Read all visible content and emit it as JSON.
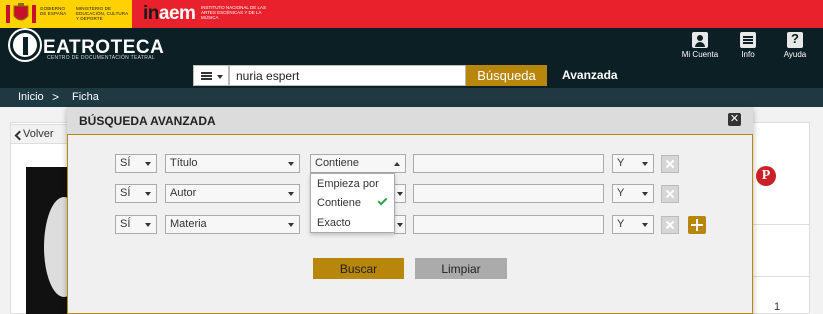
{
  "gov": {
    "text1": "GOBIERNO DE ESPAÑA",
    "text2": "MINISTERIO DE EDUCACIÓN, CULTURA Y DEPORTE",
    "inaem_logo_a": "in",
    "inaem_logo_b": "aem",
    "inaem_sub": "INSTITUTO NACIONAL DE LAS ARTES ESCÉNICAS Y DE LA MÚSICA"
  },
  "header": {
    "logo_text": "EATROTECA",
    "logo_sub": "CENTRO DE DOCUMENTACIÓN TEATRAL",
    "tools": {
      "account": "Mi Cuenta",
      "info": "Info",
      "help": "Ayuda"
    }
  },
  "search": {
    "value": "nuria espert",
    "button": "Búsqueda",
    "advanced": "Avanzada"
  },
  "breadcrumb": {
    "home": "Inicio",
    "separator": ">",
    "current": "Ficha"
  },
  "page": {
    "back": "Volver",
    "pinterest": "P",
    "page_number": "1"
  },
  "modal": {
    "title": "BÚSQUEDA AVANZADA",
    "close": "✕",
    "rows": [
      {
        "negation": "SÍ",
        "field": "Título",
        "operator": "Contiene",
        "connector": "Y"
      },
      {
        "negation": "SÍ",
        "field": "Autor",
        "operator": "",
        "connector": "Y"
      },
      {
        "negation": "SÍ",
        "field": "Materia",
        "operator": "",
        "connector": "Y"
      }
    ],
    "operator_options": [
      "Empieza por",
      "Contiene",
      "Exacto"
    ],
    "search_button": "Buscar",
    "clear_button": "Limpiar"
  },
  "colors": {
    "gold": "#b8860b",
    "dark": "#0c1f25",
    "gov_red": "#e8212c",
    "gov_yellow": "#ffd200"
  }
}
